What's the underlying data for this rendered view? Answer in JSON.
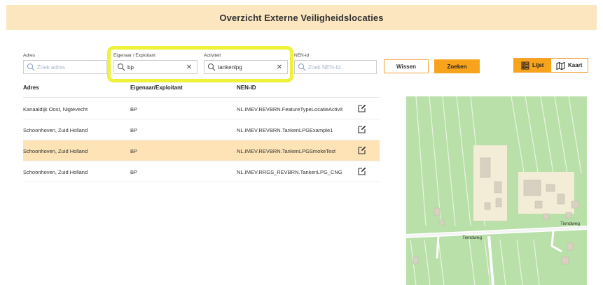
{
  "header": {
    "title": "Overzicht Externe Veiligheidslocaties"
  },
  "filters": {
    "adres": {
      "label": "Adres",
      "placeholder": "Zoek adres",
      "value": ""
    },
    "eigenaar": {
      "label": "Eigenaar / Exploitant",
      "value": "bp"
    },
    "activiteit": {
      "label": "Activiteit",
      "value": "tankenlpg"
    },
    "nen": {
      "label": "NEN-id",
      "placeholder": "Zoek NEN-Id",
      "value": ""
    },
    "highlight_color": "#eef23a"
  },
  "buttons": {
    "wissen": "Wissen",
    "zoeken": "Zoeken",
    "accent": "#f7a31c"
  },
  "view_toggle": {
    "list": "Lijst",
    "map": "Kaart",
    "active": "list"
  },
  "table": {
    "headers": [
      "Adres",
      "Eigenaar/Exploitant",
      "NEN-ID"
    ],
    "rows": [
      {
        "adres": "Kanaaldijk Oost, Nigtevecht",
        "eigenaar": "BP",
        "nen": "NL.IMEV.REVBRN.FeatureTypeLocatieActivit",
        "selected": false
      },
      {
        "adres": "Schoonhoven, Zuid Holland",
        "eigenaar": "BP",
        "nen": "NL.IMEV.REVBRN.TankenLPGExample1",
        "selected": false
      },
      {
        "adres": "Schoonhoven, Zuid Holland",
        "eigenaar": "BP",
        "nen": "NL.IMEV.REVBRN.TankenLPGSmokeTest",
        "selected": true
      },
      {
        "adres": "Schoonhoven, Zuid Holland",
        "eigenaar": "BP",
        "nen": "NL.IMEV.RRGS_REVBRN.TankenLPG_CNG",
        "selected": false
      }
    ]
  },
  "map": {
    "road_label_1": "Tiendweg",
    "road_label_2": "Tiendweg"
  }
}
